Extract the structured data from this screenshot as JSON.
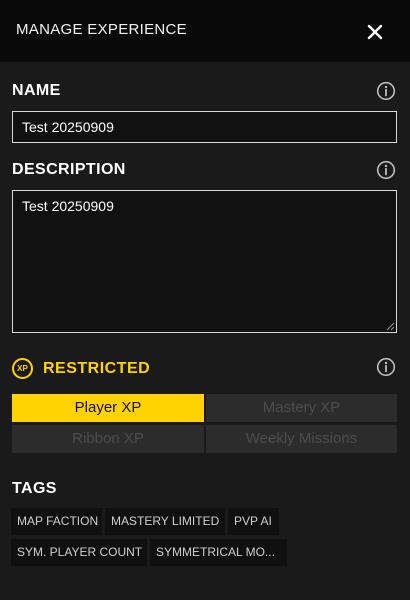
{
  "header": {
    "title": "MANAGE EXPERIENCE",
    "close_icon": "close-icon"
  },
  "name_section": {
    "title": "NAME",
    "value": "Test 20250909",
    "info_icon": "info-icon"
  },
  "description_section": {
    "title": "DESCRIPTION",
    "value": "Test 20250909",
    "info_icon": "info-icon"
  },
  "restricted_section": {
    "badge": "XP",
    "title": "RESTRICTED",
    "info_icon": "info-icon",
    "options": [
      {
        "label": "Player XP",
        "selected": true
      },
      {
        "label": "Mastery XP",
        "selected": false
      },
      {
        "label": "Ribbon XP",
        "selected": false
      },
      {
        "label": "Weekly Missions",
        "selected": false
      }
    ]
  },
  "tags_section": {
    "title": "TAGS",
    "tags": [
      "MAP FACTION",
      "MASTERY LIMITED",
      "PVP AI",
      "SYM. PLAYER COUNT",
      "SYMMETRICAL MO..."
    ]
  },
  "colors": {
    "accent": "#ffd200",
    "background": "#1a1a1a",
    "header_background": "#0a0a0a",
    "inactive_segment": "#2c2c2c",
    "tag_background": "#101010"
  }
}
